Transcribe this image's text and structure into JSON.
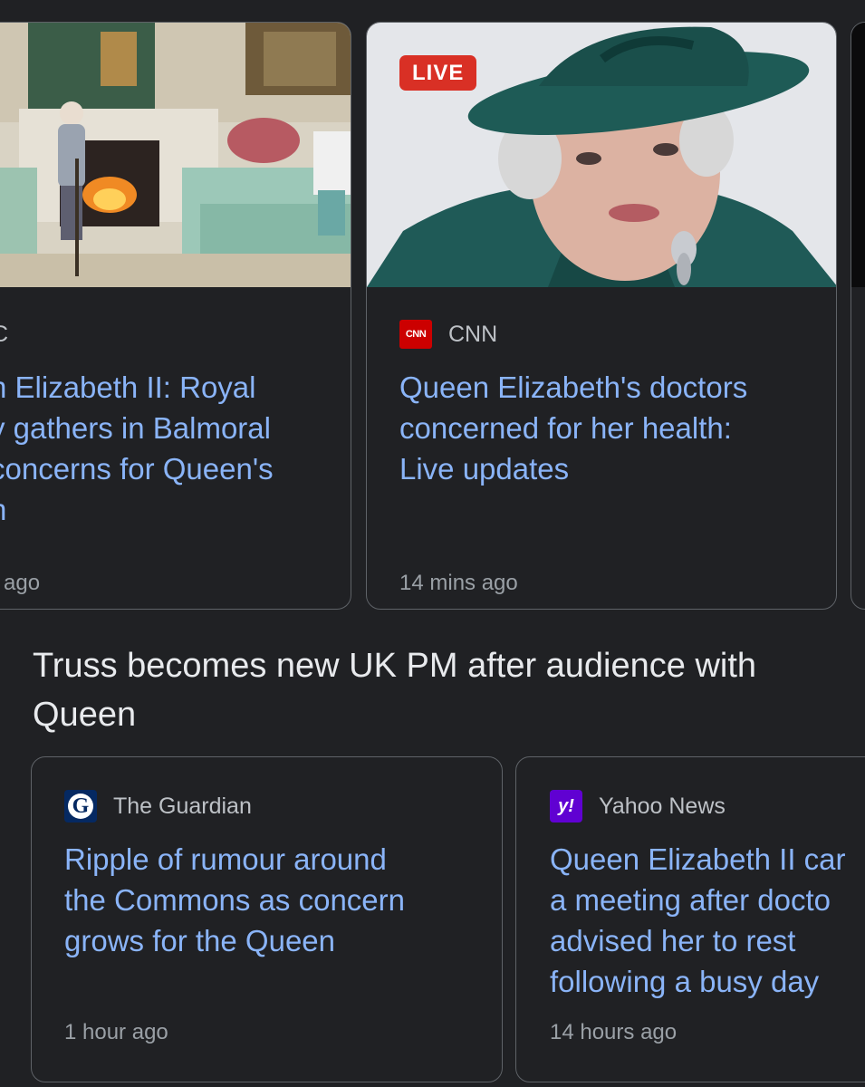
{
  "top_carousel": {
    "cards": [
      {
        "source": "C",
        "headline_lines": [
          "n Elizabeth II: Royal",
          "y gathers in Balmoral",
          "concerns for Queen's",
          "n"
        ],
        "time": "ago"
      },
      {
        "badge": "LIVE",
        "source": "CNN",
        "logo_text": "CNN",
        "headline_lines": [
          "Queen Elizabeth's doctors",
          "concerned for her health:",
          "Live updates"
        ],
        "time": "14 mins ago"
      }
    ]
  },
  "section": {
    "title": "Truss becomes new UK PM after audience with Queen",
    "cards": [
      {
        "source": "The Guardian",
        "logo_text": "G",
        "headline_lines": [
          "Ripple of rumour around",
          "the Commons as concern",
          "grows for the Queen"
        ],
        "time": "1 hour ago"
      },
      {
        "source": "Yahoo News",
        "logo_text": "y!",
        "headline_lines": [
          "Queen Elizabeth II car",
          "a meeting after docto",
          "advised her to rest",
          "following a busy day"
        ],
        "time": "14 hours ago"
      }
    ]
  },
  "colors": {
    "background": "#202124",
    "headline": "#8ab4f8",
    "live_badge": "#d93025"
  }
}
